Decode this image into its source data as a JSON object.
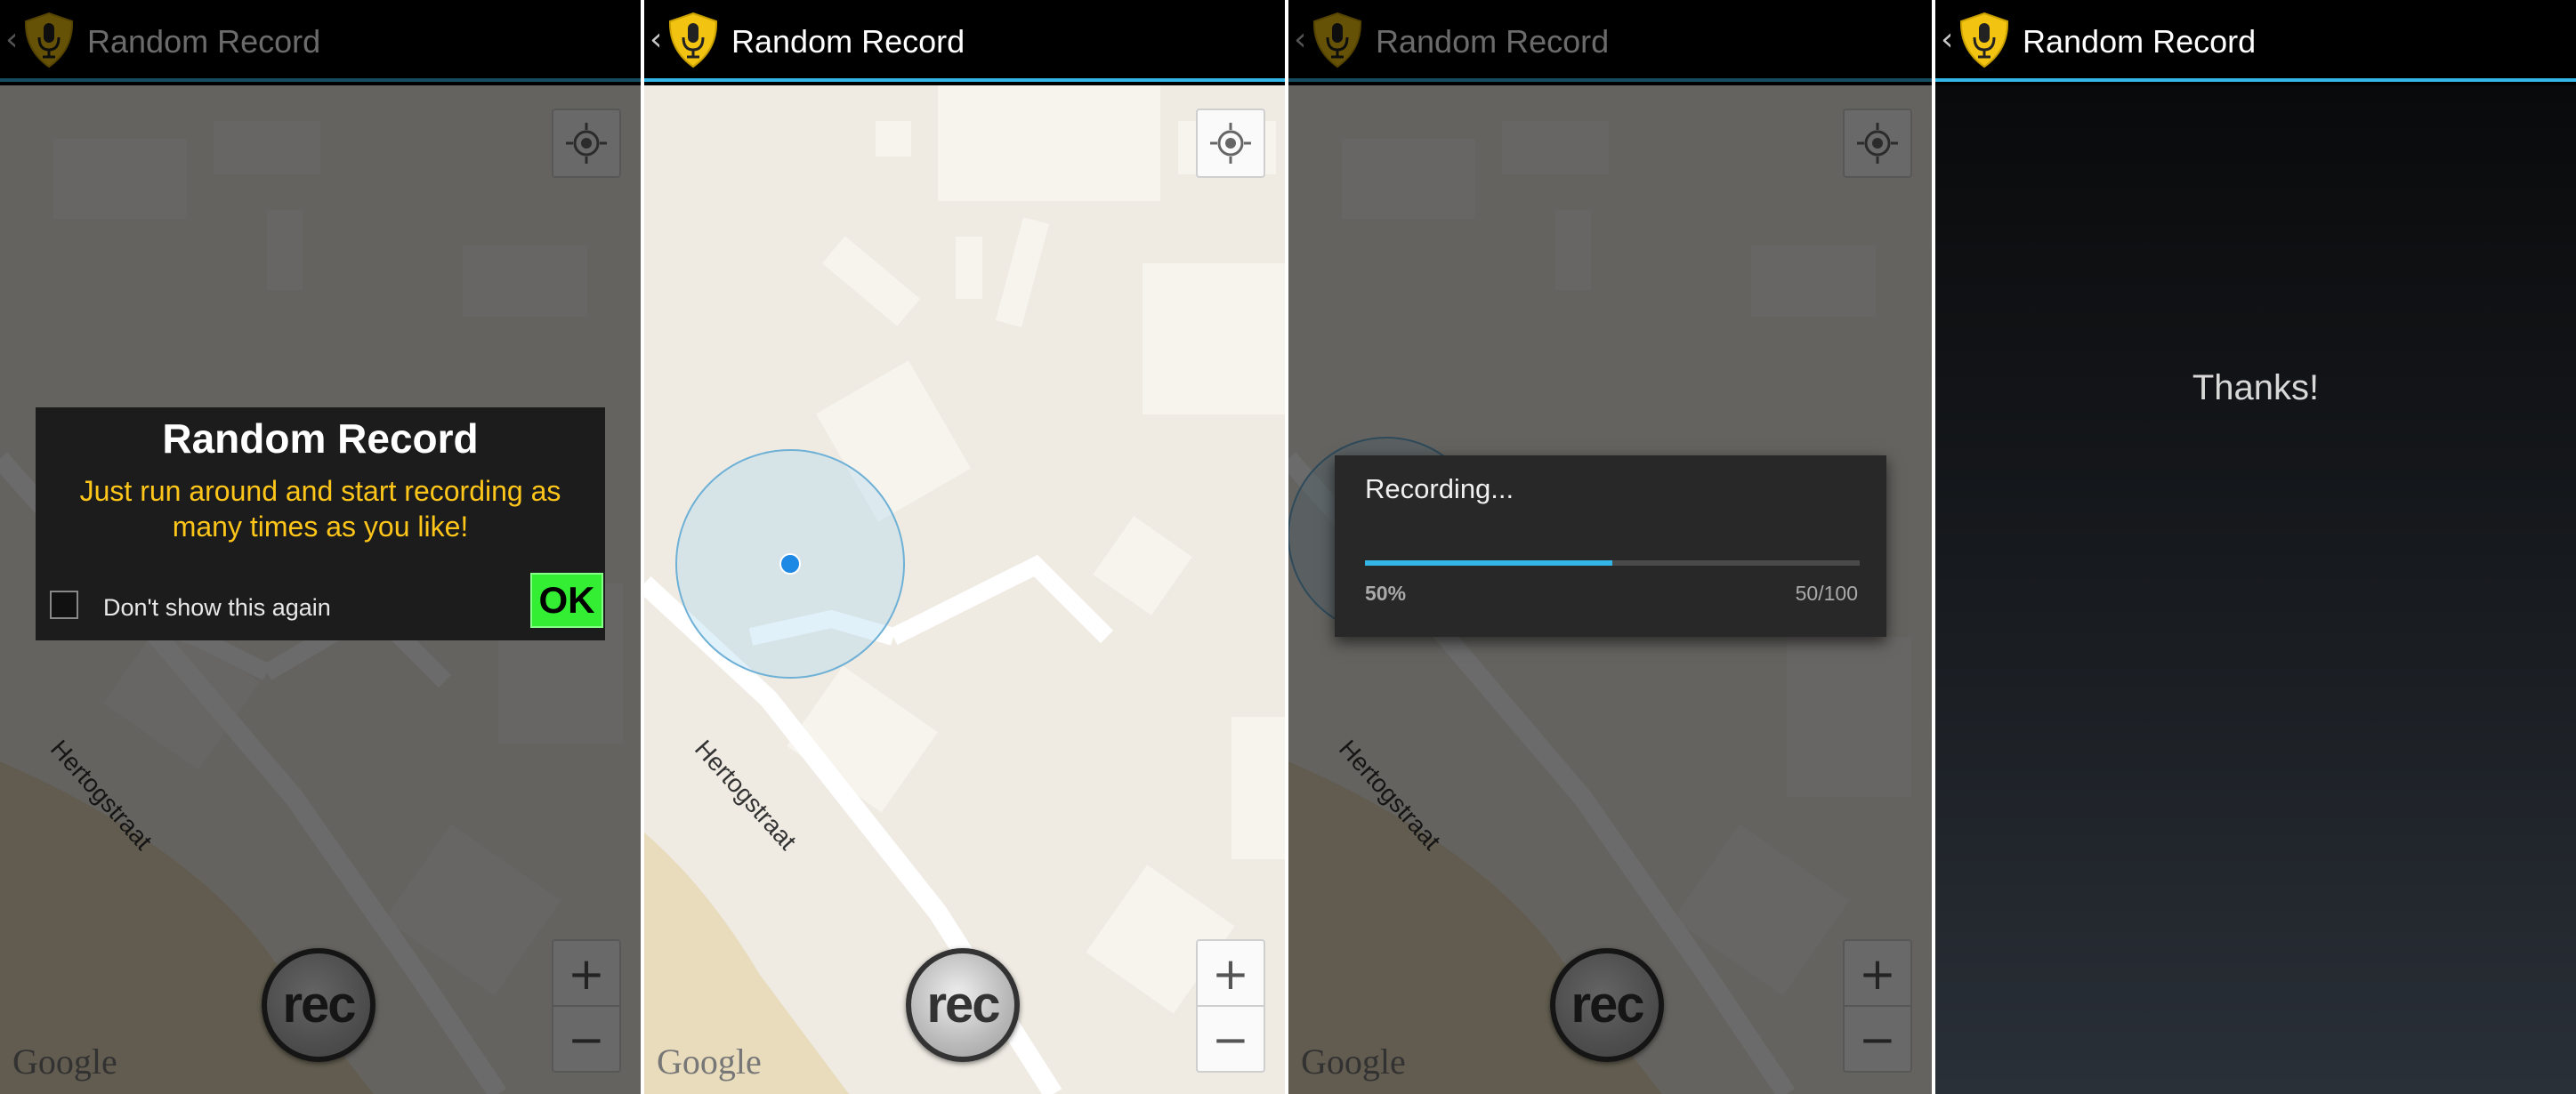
{
  "app": {
    "title": "Random Record"
  },
  "map": {
    "street_name": "Hertogstraat",
    "attribution": "Google",
    "zoom_in": "+",
    "zoom_out": "−",
    "rec_label": "rec"
  },
  "intro_dialog": {
    "title": "Random Record",
    "message": "Just run around and start recording as many times as you like!",
    "checkbox_label": "Don't show this again",
    "checkbox_checked": false,
    "ok_label": "OK"
  },
  "progress_dialog": {
    "title": "Recording...",
    "progress": 0.5,
    "percent_label": "50%",
    "count_label": "50/100"
  },
  "thanks_screen": {
    "message": "Thanks!"
  },
  "colors": {
    "accent": "#33b5e5",
    "dialog_message": "#ffc61a",
    "ok_button": "#33ee33"
  }
}
